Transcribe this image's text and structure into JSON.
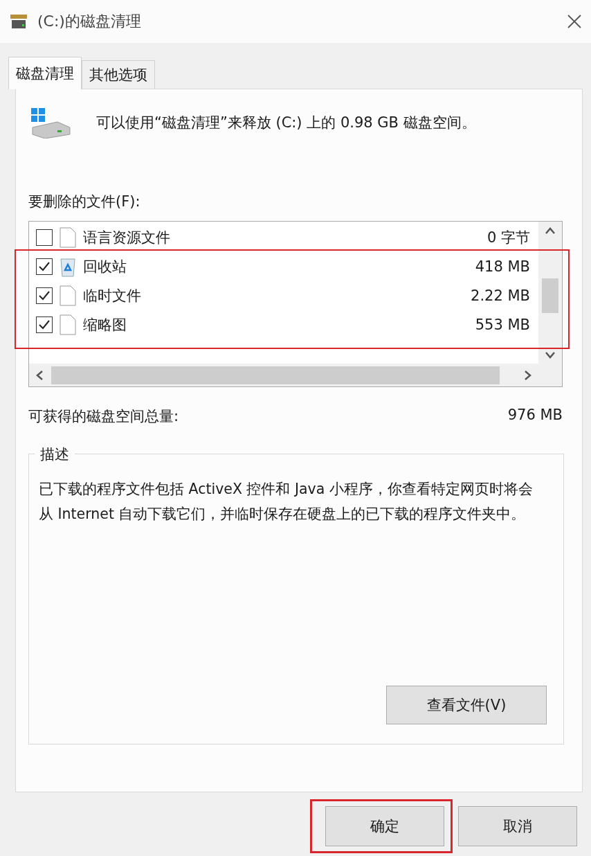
{
  "window": {
    "title": "(C:)的磁盘清理"
  },
  "tabs": [
    {
      "label": "磁盘清理",
      "selected": true
    },
    {
      "label": "其他选项",
      "selected": false
    }
  ],
  "intro": "可以使用“磁盘清理”来释放 (C:) 上的 0.98 GB 磁盘空间。",
  "files_label": "要删除的文件(F):",
  "files": [
    {
      "kind": "document",
      "name": "语言资源文件",
      "size": "0 字节",
      "checked": false,
      "highlighted": false
    },
    {
      "kind": "recycle",
      "name": "回收站",
      "size": "418 MB",
      "checked": true,
      "highlighted": true
    },
    {
      "kind": "document",
      "name": "临时文件",
      "size": "2.22 MB",
      "checked": true,
      "highlighted": true
    },
    {
      "kind": "document",
      "name": "缩略图",
      "size": "553 MB",
      "checked": true,
      "highlighted": true
    }
  ],
  "total": {
    "label": "可获得的磁盘空间总量:",
    "value": "976 MB"
  },
  "description": {
    "title": "描述",
    "text": "已下载的程序文件包括 ActiveX 控件和 Java 小程序，你查看特定网页时将会从 Internet 自动下载它们，并临时保存在硬盘上的已下载的程序文件夹中。",
    "button": "查看文件(V)"
  },
  "buttons": [
    {
      "label": "确定",
      "highlighted": true
    },
    {
      "label": "取消",
      "highlighted": false
    }
  ]
}
